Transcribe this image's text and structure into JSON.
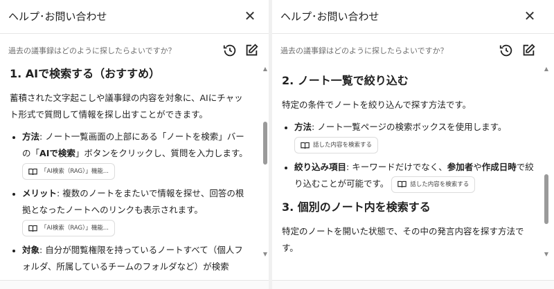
{
  "left": {
    "title": "ヘルプ･お問い合わせ",
    "close": "✕",
    "question": "過去の議事録はどのように探したらよいですか？",
    "section1_title": "1. AIで検索する（おすすめ）",
    "section1_intro": "蓄積された文字起こしや議事録の内容を対象に、AIにチャット形式で質問して情報を探し出すことができます。",
    "bullet1_label": "方法",
    "bullet1_text_a": ": ノート一覧画面の上部にある「ノートを検索」バーの「",
    "bullet1_bold": "AIで検索",
    "bullet1_text_b": "」ボタンをクリックし、質問を入力します。",
    "chip1": "「AI検索（RAG）」機能...",
    "bullet2_label": "メリット",
    "bullet2_text": ": 複数のノートをまたいで情報を探せ、回答の根拠となったノートへのリンクも表示されます。",
    "chip2": "「AI検索（RAG）」機能...",
    "bullet3_label": "対象",
    "bullet3_text": ": 自分が閲覧権限を持っているノートすべて（個人フォルダ、所属しているチームのフォルダなど）が検索"
  },
  "right": {
    "title": "ヘルプ･お問い合わせ",
    "close": "✕",
    "question": "過去の議事録はどのように探したらよいですか？",
    "section2_title": "2. ノート一覧で絞り込む",
    "section2_intro": "特定の条件でノートを絞り込んで探す方法です。",
    "bullet1_label": "方法",
    "bullet1_text": ": ノート一覧ページの検索ボックスを使用します。",
    "chip1": "話した内容を検索する",
    "bullet2_label": "絞り込み項目",
    "bullet2_text_a": ": キーワードだけでなく、",
    "bullet2_bold1": "参加者",
    "bullet2_text_b": "や",
    "bullet2_bold2": "作成日時",
    "bullet2_text_c": "で絞り込むことが可能です。",
    "chip2": "話した内容を検索する",
    "section3_title": "3. 個別のノート内を検索する",
    "section3_intro": "特定のノートを開いた状態で、その中の発言内容を探す方法です。"
  },
  "icons": {
    "history": "history-icon",
    "edit": "edit-icon",
    "book": "book-icon"
  },
  "colors": {
    "scroll_thumb": "#9a9a9a",
    "muted_text": "#6e6e6e"
  }
}
